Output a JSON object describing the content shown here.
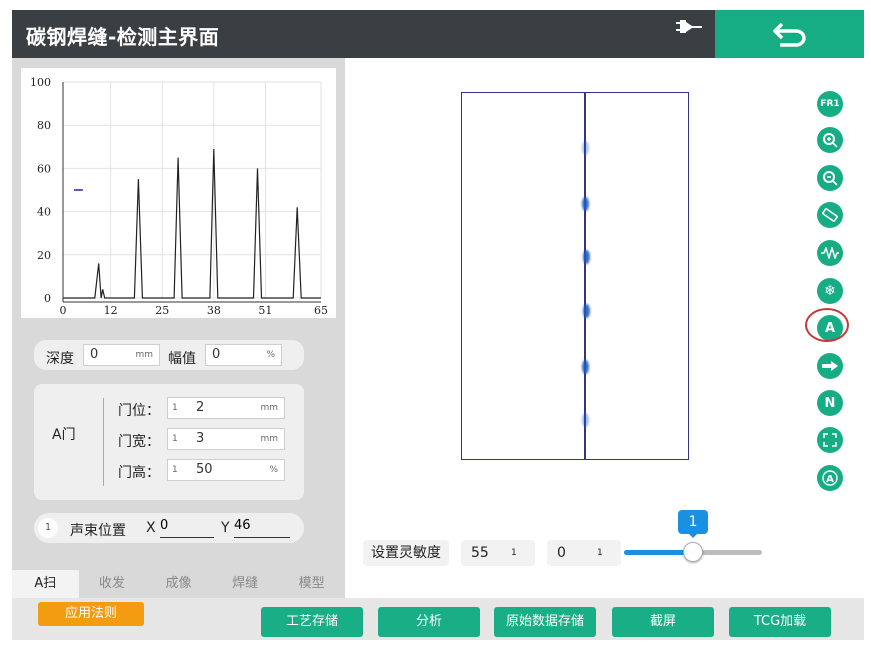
{
  "header": {
    "title": "碳钢焊缝-检测主界面",
    "plug_icon": "plug-icon",
    "back_icon": "back-arrow-icon"
  },
  "chart_data": {
    "type": "line",
    "xlim": [
      0,
      65
    ],
    "ylim": [
      0,
      100
    ],
    "x_ticks": [
      "0",
      "12",
      "25",
      "38",
      "51",
      "65"
    ],
    "y_ticks": [
      "100",
      "80",
      "60",
      "40",
      "20",
      "0"
    ],
    "grid": true,
    "gate_marker": {
      "x": 3,
      "y": 50
    },
    "series": [
      {
        "points": [
          [
            0,
            0
          ],
          [
            8,
            0
          ],
          [
            9,
            16
          ],
          [
            9.6,
            0
          ],
          [
            10,
            4
          ],
          [
            10.5,
            0
          ],
          [
            18,
            0
          ],
          [
            19,
            55
          ],
          [
            20,
            0
          ],
          [
            28,
            0
          ],
          [
            29,
            65
          ],
          [
            30,
            0
          ],
          [
            37,
            0
          ],
          [
            38,
            69
          ],
          [
            39,
            0
          ],
          [
            48,
            0
          ],
          [
            49,
            60
          ],
          [
            50,
            0
          ],
          [
            58,
            0
          ],
          [
            59,
            42
          ],
          [
            60,
            0
          ],
          [
            65,
            0
          ]
        ]
      }
    ]
  },
  "measure": {
    "depth_label": "深度",
    "depth_value": "0",
    "depth_unit": "mm",
    "amp_label": "幅值",
    "amp_value": "0",
    "amp_unit": "%"
  },
  "gate": {
    "title": "A门",
    "pos_label": "门位：",
    "pos_step": "1",
    "pos_value": "2",
    "pos_unit": "mm",
    "width_label": "门宽：",
    "width_step": "1",
    "width_value": "3",
    "width_unit": "mm",
    "height_label": "门高：",
    "height_step": "1",
    "height_value": "50",
    "height_unit": "%"
  },
  "beam": {
    "step": "1",
    "label": "声束位置",
    "x_label": "X",
    "x_value": "0",
    "y_label": "Y",
    "y_value": "46"
  },
  "tabs": [
    "A扫",
    "收发",
    "成像",
    "焊缝",
    "模型"
  ],
  "tools": [
    "FR1",
    "zoom-in-icon",
    "zoom-out-icon",
    "ruler-icon",
    "waveform-icon",
    "snowflake-icon",
    "A",
    "arrow-right-icon",
    "N",
    "expand-icon",
    "auto-icon"
  ],
  "sensitivity": {
    "label": "设置灵敏度",
    "value1": "55",
    "step1": "1",
    "value2": "0",
    "step2": "1",
    "slider_value": "1",
    "slider_fraction": 0.5
  },
  "footer": {
    "rule": "应用法则",
    "process_save": "工艺存储",
    "analysis": "分析",
    "raw_save": "原始数据存储",
    "screenshot": "截屏",
    "tcg": "TCG加载"
  },
  "colors": {
    "header": "#3a3f43",
    "accent": "#17ad84",
    "rule": "#f39c12",
    "slider": "#1b8fe0",
    "scan_border": "#34338a"
  }
}
